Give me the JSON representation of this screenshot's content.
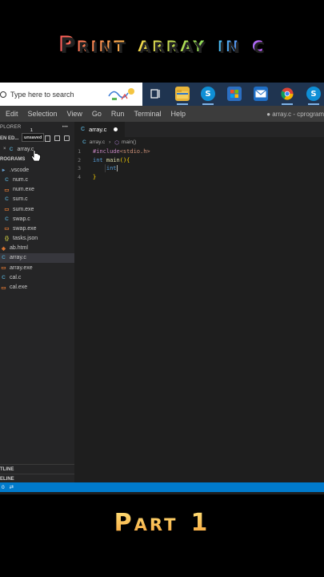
{
  "overlay": {
    "title_words": [
      "Print",
      "array",
      "in",
      "c"
    ],
    "part_words": [
      "Part",
      "1"
    ]
  },
  "taskbar": {
    "search_placeholder": "Type here to search",
    "icons": [
      "task-view-icon",
      "file-explorer-icon",
      "skype-icon",
      "store-icon",
      "mail-icon",
      "chrome-icon",
      "skype-tray-icon"
    ]
  },
  "menubar": {
    "items": [
      "Edit",
      "Selection",
      "View",
      "Go",
      "Run",
      "Terminal",
      "Help"
    ],
    "window_title": "● array.c - cprogram"
  },
  "sidebar": {
    "header": "PLORER",
    "open_editors": "EN ED...",
    "open_file": "array.c",
    "unsaved_tooltip": "unsaved",
    "unsaved_count": "1",
    "folder": "ROGRAMS",
    "files": [
      {
        "name": ".vscode",
        "type": "folder"
      },
      {
        "name": "num.c",
        "type": "c"
      },
      {
        "name": "num.exe",
        "type": "exe"
      },
      {
        "name": "sum.c",
        "type": "c"
      },
      {
        "name": "sum.exe",
        "type": "exe"
      },
      {
        "name": "swap.c",
        "type": "c"
      },
      {
        "name": "swap.exe",
        "type": "exe"
      },
      {
        "name": "tasks.json",
        "type": "json"
      },
      {
        "name": "ab.html",
        "type": "html"
      },
      {
        "name": "array.c",
        "type": "c"
      },
      {
        "name": "array.exe",
        "type": "exe"
      },
      {
        "name": "cal.c",
        "type": "c"
      },
      {
        "name": "cal.exe",
        "type": "exe"
      }
    ],
    "selected_file": "array.c",
    "outline": "TLINE",
    "timeline": "ELINE"
  },
  "editor": {
    "tab_label": "array.c",
    "breadcrumb_file": "array.c",
    "breadcrumb_symbol": "main()",
    "lines": [
      {
        "num": "1",
        "pp": "#include",
        "str": "<stdio.h>"
      },
      {
        "num": "2",
        "kw": "int",
        "fn": "main",
        "rest": "(){"
      },
      {
        "num": "3",
        "kw": "int"
      },
      {
        "num": "4",
        "brace": "}"
      }
    ]
  },
  "statusbar": {
    "errors": "0"
  },
  "colors": {
    "status_blue": "#007acc",
    "editor_bg": "#1e1e1e",
    "sidebar_bg": "#252526",
    "taskbar_bg": "#1f3450"
  }
}
